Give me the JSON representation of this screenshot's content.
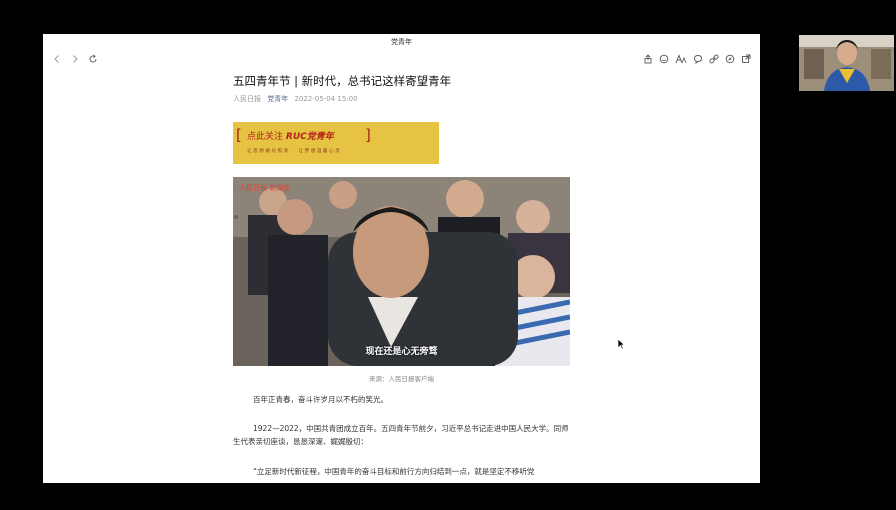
{
  "window": {
    "title": "党青年"
  },
  "article": {
    "title": "五四青年节 | 新时代，总书记这样寄望青年",
    "source": "人民日报",
    "account": "党青年",
    "date": "2022-05-04 15:00",
    "banner": {
      "left_bracket": "[",
      "right_bracket": "]",
      "main_prefix": "点此关注",
      "main_brand": "RUC党青年",
      "sub": "让思想被光照亮 · 让梦想温暖心灵"
    },
    "video": {
      "watermark": "人民日报 新媒体",
      "subtitle": "现在还是心无旁骛"
    },
    "caption": "来源：人民日报客户端",
    "paragraphs": [
      "百年正青春，奋斗许岁月以不朽的笑光。",
      "1922—2022，中国共青团成立百年。五四青年节前夕，习近平总书记走进中国人民大学。同师生代表亲切座谈，恳恳深邃、娓娓殷切：",
      "“立足新时代新征程，中国青年的奋斗目标和前行方向归结到一点，就是坚定不移听党"
    ]
  },
  "icons": {
    "left": [
      "back-icon",
      "forward-icon",
      "refresh-icon"
    ],
    "right": [
      "share-icon",
      "emoji-icon",
      "font-icon",
      "comment-icon",
      "link-icon",
      "compass-icon",
      "open-external-icon"
    ]
  }
}
